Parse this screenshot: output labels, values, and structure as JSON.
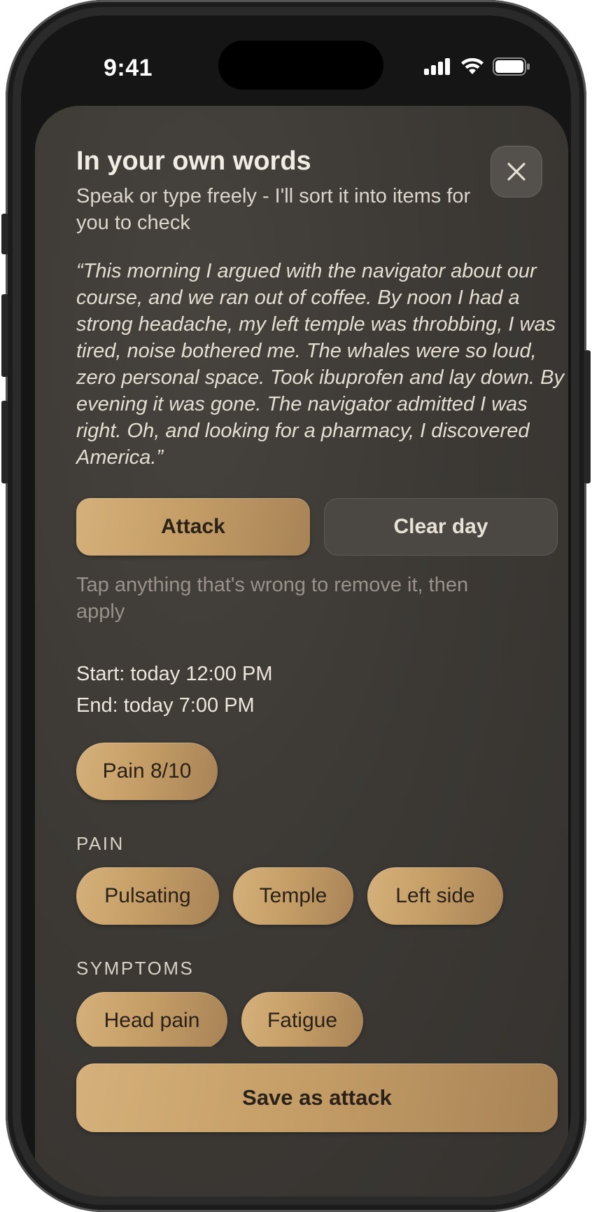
{
  "status_bar": {
    "time": "9:41",
    "icons": [
      "signal-icon",
      "wifi-icon",
      "battery-icon"
    ]
  },
  "sheet": {
    "title": "In your own words",
    "subtitle": "Speak or type freely - I'll sort it into items for you to check",
    "close_icon": "close-icon",
    "quote": "“This morning I argued with the navigator about our course, and we ran out of coffee. By noon I had a strong headache, my left temple was throbbing, I was tired, noise bothered me. The whales were so loud, zero personal space. Took ibuprofen and lay down. By evening it was gone. The navigator admitted I was right. Oh, and looking for a pharmacy, I discovered America.”",
    "mode_buttons": {
      "attack": "Attack",
      "clear_day": "Clear day"
    },
    "hint": "Tap anything that's wrong to remove it, then apply",
    "start": "Start: today 12:00 PM",
    "end": "End: today 7:00 PM",
    "pain_level_chip": "Pain 8/10",
    "pain_section": {
      "label": "PAIN",
      "chips": [
        "Pulsating",
        "Temple",
        "Left side"
      ]
    },
    "symptoms_section": {
      "label": "SYMPTOMS",
      "chips": [
        "Head pain",
        "Fatigue"
      ]
    },
    "save_button": "Save as attack"
  },
  "colors": {
    "accent_gold": "#c9a36b",
    "sheet_background": "#3c3935",
    "text_primary": "#f1ece4",
    "text_muted": "#99918a"
  }
}
